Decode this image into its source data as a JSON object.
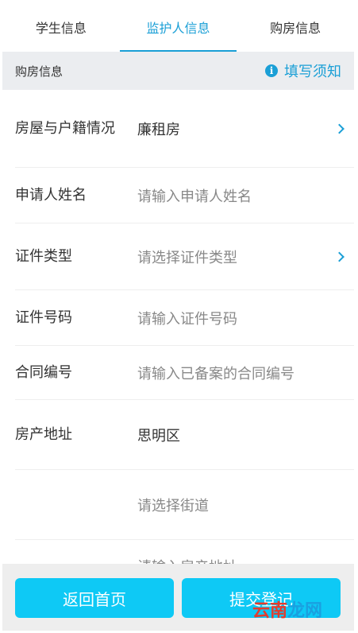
{
  "tabs": [
    {
      "label": "学生信息",
      "active": false
    },
    {
      "label": "监护人信息",
      "active": true
    },
    {
      "label": "购房信息",
      "active": false
    }
  ],
  "section": {
    "title": "购房信息",
    "notice_label": "填写须知",
    "notice_icon": "info-icon"
  },
  "form": {
    "housing_status": {
      "label": "房屋与户籍情况",
      "value": "廉租房"
    },
    "applicant_name": {
      "label": "申请人姓名",
      "placeholder": "请输入申请人姓名"
    },
    "id_type": {
      "label": "证件类型",
      "placeholder": "请选择证件类型"
    },
    "id_number": {
      "label": "证件号码",
      "placeholder": "请输入证件号码"
    },
    "contract_number": {
      "label": "合同编号",
      "placeholder": "请输入已备案的合同编号"
    },
    "property_address": {
      "label": "房产地址",
      "district": "思明区",
      "street_placeholder": "请选择街道",
      "address_placeholder": "请输入房产地址"
    }
  },
  "footer": {
    "back_label": "返回首页",
    "submit_label": "提交登记"
  },
  "watermark": {
    "part1": "云南",
    "part2": "龙网"
  },
  "colors": {
    "accent": "#1a9fd6",
    "button": "#0ec9f5",
    "header_bg": "#ebedf0"
  }
}
